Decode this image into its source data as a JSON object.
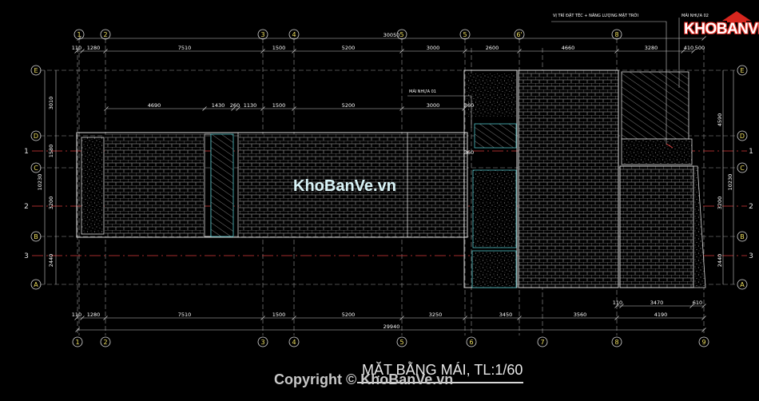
{
  "grid_top": [
    "1",
    "2",
    "3",
    "4",
    "5",
    "5",
    "6'",
    "8"
  ],
  "grid_bottom": [
    "1",
    "2",
    "3",
    "4",
    "5",
    "6",
    "7",
    "8",
    "9"
  ],
  "grid_rows": [
    "E",
    "D",
    "C",
    "B",
    "A"
  ],
  "red_axes": [
    "1",
    "2",
    "3"
  ],
  "dims_top_total": "30050",
  "dims_top": [
    "110",
    "1280",
    "7510",
    "1500",
    "5200",
    "3000",
    "2600",
    "4660",
    "3280",
    "410",
    "500"
  ],
  "dims_inner": [
    "4690",
    "1430",
    "260",
    "1130",
    "1500",
    "5200",
    "3000",
    "360",
    "360"
  ],
  "dims_bottom_upper": [
    "110",
    "3470",
    "610"
  ],
  "dims_bottom": [
    "110",
    "1280",
    "7510",
    "1500",
    "5200",
    "3250",
    "3450",
    "3560",
    "4190"
  ],
  "dims_bottom_total": "29940",
  "dims_left": [
    "3010",
    "1580",
    "10230",
    "3200",
    "2440"
  ],
  "dims_right": [
    "4590",
    "10230",
    "3200",
    "2440"
  ],
  "labels": {
    "solar": "VỊ TRÍ ĐẶT TÉC + NĂNG LƯỢNG MẶT TRỜI",
    "roof_sheet_01": "MÁI NHỰA 01",
    "roof_sheet_02": "MÁI NHỰA 02"
  },
  "drawing_title": "MẶT BẰNG MÁI, TL:1/60",
  "watermark_center": "KhoBanVe.vn",
  "copyright": "Copyright © KhoBanVe.vn",
  "logo_text": "KHOBANVE",
  "colors": {
    "grid_line": "#c8c8c8",
    "axis_red": "#e04040",
    "outline": "#d8d8d8",
    "tile": "#808080",
    "cyan": "#4fc3c8",
    "text": "#ffffff"
  }
}
